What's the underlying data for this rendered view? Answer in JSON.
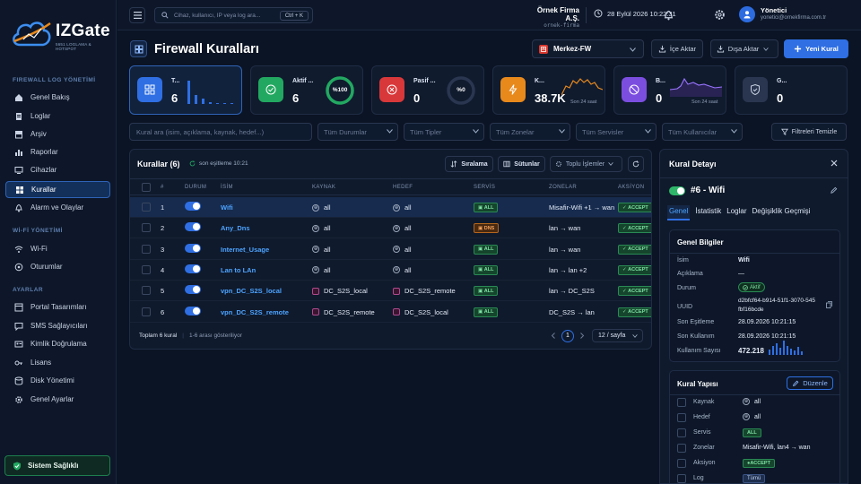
{
  "app": {
    "name": "IZGate",
    "subtitle": "5651 LOGLAMA & HOTSPOT"
  },
  "sidebar": {
    "sections": [
      {
        "title": "FIREWALL LOG YÖNETİMİ",
        "items": [
          {
            "label": "Genel Bakış",
            "icon": "home-icon"
          },
          {
            "label": "Loglar",
            "icon": "document-icon"
          },
          {
            "label": "Arşiv",
            "icon": "archive-icon"
          },
          {
            "label": "Raporlar",
            "icon": "chart-icon"
          },
          {
            "label": "Cihazlar",
            "icon": "monitor-icon"
          },
          {
            "label": "Kurallar",
            "icon": "grid-icon",
            "active": true
          },
          {
            "label": "Alarm ve Olaylar",
            "icon": "bell-icon"
          }
        ]
      },
      {
        "title": "Wİ-Fİ YÖNETİMİ",
        "items": [
          {
            "label": "Wi-Fi",
            "icon": "wifi-icon"
          },
          {
            "label": "Oturumlar",
            "icon": "users-icon"
          }
        ]
      },
      {
        "title": "AYARLAR",
        "items": [
          {
            "label": "Portal Tasarımları",
            "icon": "layout-icon"
          },
          {
            "label": "SMS Sağlayıcıları",
            "icon": "message-icon"
          },
          {
            "label": "Kimlik Doğrulama",
            "icon": "id-card-icon"
          },
          {
            "label": "Lisans",
            "icon": "key-icon"
          },
          {
            "label": "Disk Yönetimi",
            "icon": "disk-icon"
          },
          {
            "label": "Genel Ayarlar",
            "icon": "gear-icon"
          }
        ]
      }
    ],
    "health_label": "Sistem Sağlıklı"
  },
  "topbar": {
    "search_placeholder": "Cihaz, kullanıcı, IP veya log ara...",
    "search_shortcut": "Ctrl + K",
    "company_name": "Örnek Firma A.Ş.",
    "company_sub": "ornek-firma",
    "datetime": "28 Eylül 2026 10:22:31",
    "user_name": "Yönetici",
    "user_email": "yonetici@ornekfirma.com.tr"
  },
  "header": {
    "title": "Firewall Kuralları",
    "device": "Merkez-FW",
    "import_label": "İçe Aktar",
    "export_label": "Dışa Aktar",
    "new_label": "Yeni Kural"
  },
  "stats": [
    {
      "label": "T...",
      "value": "6",
      "color": "#2f6fe3"
    },
    {
      "label": "Aktif ...",
      "value": "6",
      "ring": "%100",
      "color": "#23a861"
    },
    {
      "label": "Pasif ...",
      "value": "0",
      "ring": "%0",
      "color": "#d9383a"
    },
    {
      "label": "K...",
      "value": "38.7K",
      "sub": "Son 24 saat",
      "color": "#e8891c"
    },
    {
      "label": "B...",
      "value": "0",
      "sub": "Son 24 saat",
      "color": "#7c4ee0"
    },
    {
      "label": "G...",
      "value": "0",
      "color": "#5a6a85"
    }
  ],
  "filters": {
    "search_placeholder": "Kural ara (isim, açıklama, kaynak, hedef...)",
    "status": "Tüm Durumlar",
    "type": "Tüm Tipler",
    "zone": "Tüm Zonelar",
    "service": "Tüm Servisler",
    "user": "Tüm Kullanıcılar",
    "clear": "Filtreleri Temizle"
  },
  "table": {
    "title": "Kurallar (6)",
    "sync": "son eşitleme 10:21",
    "sort_label": "Sıralama",
    "columns_label": "Sütunlar",
    "bulk_label": "Toplu İşlemler",
    "headers": [
      "#",
      "DURUM",
      "İSİM",
      "KAYNAK",
      "HEDEF",
      "SERVİS",
      "ZONELAR",
      "AKSİYON"
    ],
    "rows": [
      {
        "no": "1",
        "name": "Wifi",
        "source": "all",
        "dest": "all",
        "service": "ALL",
        "zones": "Misafir-Wifi +1 → wan",
        "action": "ACCEPT",
        "selected": true
      },
      {
        "no": "2",
        "name": "Any_Dns",
        "source": "all",
        "dest": "all",
        "service": "DNS",
        "zones": "lan → wan",
        "action": "ACCEPT"
      },
      {
        "no": "3",
        "name": "Internet_Usage",
        "source": "all",
        "dest": "all",
        "service": "ALL",
        "zones": "lan → wan",
        "action": "ACCEPT"
      },
      {
        "no": "4",
        "name": "Lan to LAn",
        "source": "all",
        "dest": "all",
        "service": "ALL",
        "zones": "lan → lan +2",
        "action": "ACCEPT"
      },
      {
        "no": "5",
        "name": "vpn_DC_S2S_local",
        "source": "DC_S2S_local",
        "dest": "DC_S2S_remote",
        "service": "ALL",
        "zones": "lan → DC_S2S",
        "action": "ACCEPT",
        "group": true
      },
      {
        "no": "6",
        "name": "vpn_DC_S2S_remote",
        "source": "DC_S2S_remote",
        "dest": "DC_S2S_local",
        "service": "ALL",
        "zones": "DC_S2S → lan",
        "action": "ACCEPT",
        "group": true
      }
    ],
    "footer_total": "Toplam 6 kural",
    "footer_range": "1-6 arası gösteriliyor",
    "page": "1",
    "page_size": "12 / sayfa"
  },
  "detail": {
    "title": "Kural Detayı",
    "rule_name": "#6 - Wifi",
    "tabs": [
      "Genel",
      "İstatistik",
      "Loglar",
      "Değişiklik Geçmişi"
    ],
    "general_title": "Genel Bilgiler",
    "general": [
      {
        "k": "İsim",
        "v": "Wifi"
      },
      {
        "k": "Açıklama",
        "v": "—"
      },
      {
        "k": "Durum",
        "v": "Aktif"
      },
      {
        "k": "UUID",
        "v": "d2bfcf64-b914-51f1-3070-545",
        "v2": "fbf16bcde"
      },
      {
        "k": "Son Eşitleme",
        "v": "28.09.2026 10:21:15"
      },
      {
        "k": "Son Kullanım",
        "v": "28.09.2026 10:21:15"
      },
      {
        "k": "Kullanım Sayısı",
        "v": "472.218"
      }
    ],
    "structure_title": "Kural Yapısı",
    "edit_label": "Düzenle",
    "structure": [
      {
        "k": "Kaynak",
        "v": "all"
      },
      {
        "k": "Hedef",
        "v": "all"
      },
      {
        "k": "Servis",
        "v": "ALL"
      },
      {
        "k": "Zonelar",
        "v": "Misafir-Wifi, lan4 → wan"
      },
      {
        "k": "Aksiyon",
        "v": "ACCEPT"
      },
      {
        "k": "Log",
        "v": "Tümü"
      }
    ]
  }
}
